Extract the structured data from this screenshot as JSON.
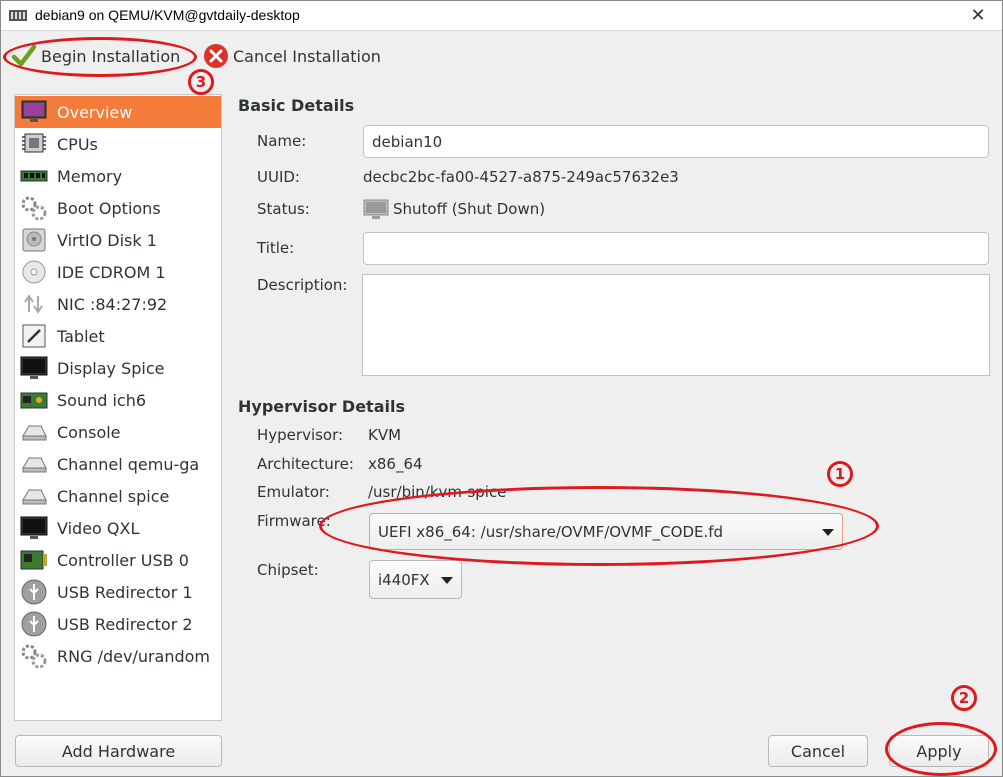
{
  "window": {
    "title": "debian9 on QEMU/KVM@gvtdaily-desktop",
    "close_glyph": "✕"
  },
  "toolbar": {
    "begin_label": "Begin Installation",
    "cancel_label": "Cancel Installation"
  },
  "sidebar": {
    "items": [
      {
        "label": "Overview",
        "icon": "monitor-icon"
      },
      {
        "label": "CPUs",
        "icon": "cpu-icon"
      },
      {
        "label": "Memory",
        "icon": "memory-icon"
      },
      {
        "label": "Boot Options",
        "icon": "gears-icon"
      },
      {
        "label": "VirtIO Disk 1",
        "icon": "disk-icon"
      },
      {
        "label": "IDE CDROM 1",
        "icon": "cdrom-icon"
      },
      {
        "label": "NIC :84:27:92",
        "icon": "network-icon"
      },
      {
        "label": "Tablet",
        "icon": "tablet-icon"
      },
      {
        "label": "Display Spice",
        "icon": "display-icon"
      },
      {
        "label": "Sound ich6",
        "icon": "sound-card-icon"
      },
      {
        "label": "Console",
        "icon": "serial-icon"
      },
      {
        "label": "Channel qemu-ga",
        "icon": "serial-icon"
      },
      {
        "label": "Channel spice",
        "icon": "serial-icon"
      },
      {
        "label": "Video QXL",
        "icon": "display-icon"
      },
      {
        "label": "Controller USB 0",
        "icon": "controller-icon"
      },
      {
        "label": "USB Redirector 1",
        "icon": "usb-icon"
      },
      {
        "label": "USB Redirector 2",
        "icon": "usb-icon"
      },
      {
        "label": "RNG /dev/urandom",
        "icon": "gears-icon"
      }
    ],
    "add_hardware_label": "Add Hardware"
  },
  "basic": {
    "heading": "Basic Details",
    "name_label": "Name:",
    "name_value": "debian10",
    "uuid_label": "UUID:",
    "uuid_value": "decbc2bc-fa00-4527-a875-249ac57632e3",
    "status_label": "Status:",
    "status_value": "Shutoff (Shut Down)",
    "title_label": "Title:",
    "title_value": "",
    "description_label": "Description:",
    "description_value": ""
  },
  "hypervisor": {
    "heading": "Hypervisor Details",
    "hypervisor_label": "Hypervisor:",
    "hypervisor_value": "KVM",
    "arch_label": "Architecture:",
    "arch_value": "x86_64",
    "emulator_label": "Emulator:",
    "emulator_value": "/usr/bin/kvm-spice",
    "firmware_label": "Firmware:",
    "firmware_value": "UEFI x86_64: /usr/share/OVMF/OVMF_CODE.fd",
    "chipset_label": "Chipset:",
    "chipset_value": "i440FX"
  },
  "footer": {
    "cancel_label": "Cancel",
    "apply_label": "Apply"
  },
  "annotations": {
    "step1": "1",
    "step2": "2",
    "step3": "3",
    "color": "#e0191e"
  },
  "colors": {
    "selection": "#f47b3a",
    "window_bg": "#efefef"
  }
}
